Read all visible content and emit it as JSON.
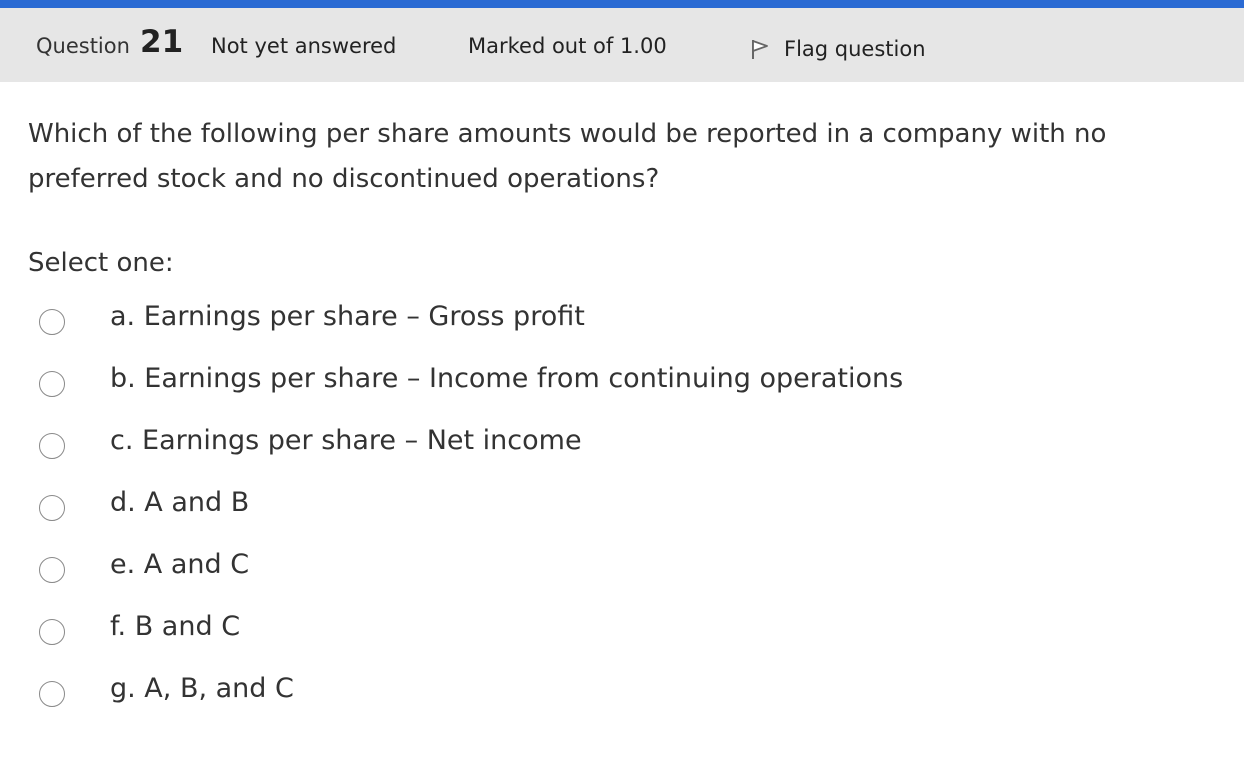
{
  "question": {
    "label": "Question",
    "number": "21",
    "state": "Not yet answered",
    "grade": "Marked out of 1.00",
    "flag_label": "Flag question",
    "flag_icon": "flag-outline-icon",
    "text": "Which of the following per share amounts would be reported in a company with no preferred stock and no discontinued operations?",
    "prompt": "Select one:",
    "options": [
      {
        "label": "a. Earnings per share – Gross profit"
      },
      {
        "label": "b. Earnings per share – Income from continuing operations"
      },
      {
        "label": "c. Earnings per share – Net income"
      },
      {
        "label": "d. A and B"
      },
      {
        "label": "e. A and C"
      },
      {
        "label": "f. B and C"
      },
      {
        "label": "g. A, B, and C"
      }
    ]
  },
  "colors": {
    "accent": "#2a6ad3",
    "info_bar_bg": "#e6e6e6"
  }
}
